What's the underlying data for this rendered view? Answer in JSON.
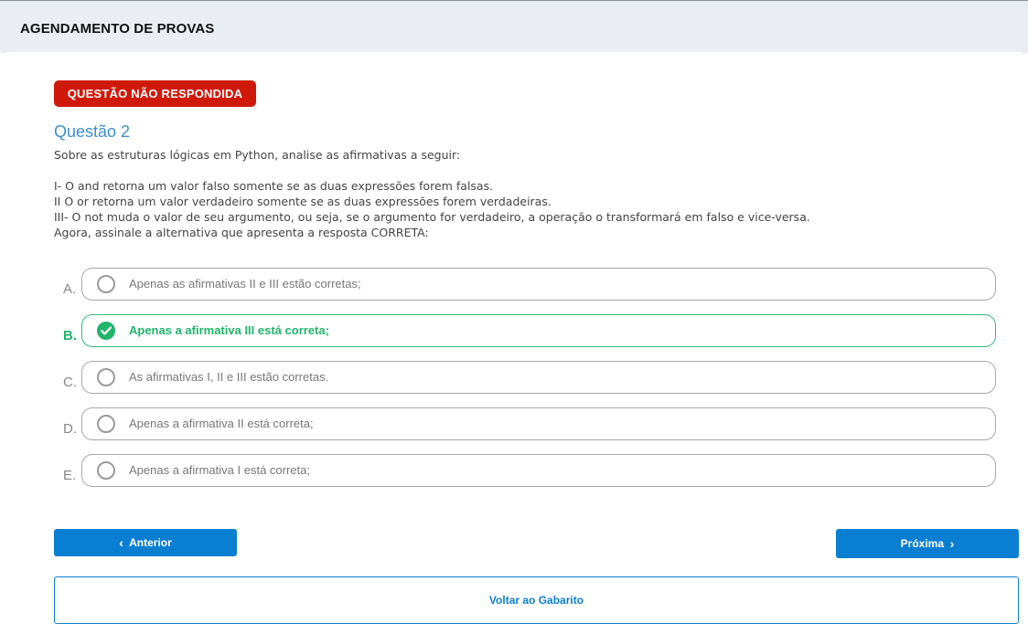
{
  "header": {
    "title": "AGENDAMENTO DE PROVAS"
  },
  "status": {
    "label": "QUESTÃO NÃO RESPONDIDA",
    "color": "#cf1a0b"
  },
  "question": {
    "title": "Questão 2",
    "intro": "Sobre as estruturas lógicas em Python, analise as afirmativas a seguir:",
    "statements": [
      "I- O and retorna um valor falso somente se as duas expressões forem falsas.",
      "II O or retorna um valor verdadeiro somente se as duas expressões forem verdadeiras.",
      "III- O not muda o valor de seu argumento, ou seja, se o argumento for verdadeiro, a operação o transformará em falso e vice-versa.",
      "Agora, assinale a alternativa que apresenta a resposta CORRETA:"
    ]
  },
  "options": [
    {
      "letter": "A.",
      "text": "Apenas as afirmativas II e III estão corretas;",
      "correct": false
    },
    {
      "letter": "B.",
      "text": "Apenas a afirmativa III está correta;",
      "correct": true
    },
    {
      "letter": "C.",
      "text": "As afirmativas I, II e III estão corretas.",
      "correct": false
    },
    {
      "letter": "D.",
      "text": "Apenas a afirmativa II está correta;",
      "correct": false
    },
    {
      "letter": "E.",
      "text": "Apenas a afirmativa I está correta;",
      "correct": false
    }
  ],
  "navigation": {
    "prev_label": "Anterior",
    "next_label": "Próxima",
    "back_label": "Voltar ao Gabarito"
  },
  "colors": {
    "accent": "#0a7fd2",
    "correct": "#1fb56b",
    "title": "#3a8fd0"
  }
}
